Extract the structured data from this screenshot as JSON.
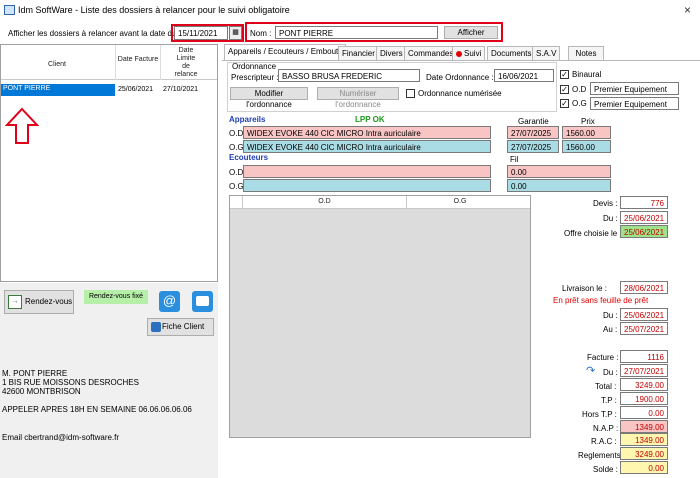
{
  "window": {
    "title": "Idm SoftWare - Liste des dossiers à relancer pour le suivi obligatoire",
    "close": "×"
  },
  "filter": {
    "date_label": "Afficher les dossiers à relancer avant la date du :",
    "date_value": "15/11/2021",
    "nom_label": "Nom :",
    "nom_value": "PONT PIERRE",
    "afficher": "Afficher"
  },
  "list": {
    "headers": {
      "client": "Client",
      "date_facture": "Date Facture",
      "date_limite_1": "Date",
      "date_limite_2": "Limite",
      "date_limite_3": "de",
      "date_limite_4": "relance"
    },
    "row": {
      "client": "PONT PIERRE",
      "date_facture": "25/06/2021",
      "date_limite": "27/10/2021"
    }
  },
  "actions": {
    "rdv": "Rendez-vous",
    "rdv_fixe": "Rendez-vous fixé",
    "fiche_client": "Fiche Client"
  },
  "client_info": {
    "line1": "M. PONT PIERRE",
    "line2": "1 BIS RUE MOISSONS DESROCHES",
    "line3": "42600 MONTBRISON",
    "note": "APPELER APRES 18H EN SEMAINE 06.06.06.06.06",
    "email": "Email cbertrand@idm-software.fr"
  },
  "tabs": [
    "Appareils / Ecouteurs / Embouts",
    "Financier",
    "Divers",
    "Commandes",
    "Suivi",
    "Documents",
    "S.A.V",
    "Notes"
  ],
  "ordonnance": {
    "group": "Ordonnance",
    "prescripteur_label": "Prescripteur :",
    "prescripteur": "BASSO BRUSA FREDERIC",
    "date_label": "Date Ordonnance :",
    "date": "16/06/2021",
    "modifier": "Modifier l'ordonnance",
    "numeriser": "Numériser l'ordonnance",
    "numerisee": "Ordonnance numérisée",
    "binaural": "Binaural",
    "od": "O.D",
    "og": "O.G",
    "od_type": "Premier Equipement",
    "og_type": "Premier Equipement"
  },
  "appareils": {
    "title": "Appareils",
    "lpp": "LPP OK",
    "garantie_label": "Garantie",
    "prix_label": "Prix",
    "od_label": "O.D",
    "og_label": "O.G",
    "od_name": "WIDEX EVOKE 440 CIC MICRO Intra auriculaire",
    "og_name": "WIDEX EVOKE 440 CIC MICRO Intra auriculaire",
    "od_garantie": "27/07/2025",
    "og_garantie": "27/07/2025",
    "od_prix": "1560.00",
    "og_prix": "1560.00"
  },
  "ecouteurs": {
    "title": "Ecouteurs",
    "fil_label": "Fil",
    "od_label": "O.D",
    "og_label": "O.G",
    "od_fil": "0.00",
    "og_fil": "0.00"
  },
  "grid": {
    "od": "O.D",
    "og": "O.G"
  },
  "devis": {
    "devis_label": "Devis :",
    "devis": "776",
    "du_label": "Du :",
    "du": "25/06/2021",
    "offre_label": "Offre choisie le :",
    "offre": "25/06/2021"
  },
  "livraison": {
    "label": "Livraison le :",
    "date": "28/06/2021",
    "pret_note": "En prêt sans feuille de prêt",
    "du_label": "Du :",
    "du": "25/06/2021",
    "au_label": "Au :",
    "au": "25/07/2021"
  },
  "facture": {
    "facture_label": "Facture :",
    "facture": "1116",
    "du_label": "Du :",
    "du": "27/07/2021",
    "total_label": "Total :",
    "total": "3249.00",
    "tp_label": "T.P :",
    "tp": "1900.00",
    "hors_tp_label": "Hors T.P :",
    "hors_tp": "0.00",
    "nap_label": "N.A.P :",
    "nap": "1349.00",
    "rac_label": "R.A.C :",
    "rac": "1349.00",
    "reglements_label": "Reglements :",
    "reglements": "3249.00",
    "solde_label": "Solde :",
    "solde": "0.00"
  }
}
